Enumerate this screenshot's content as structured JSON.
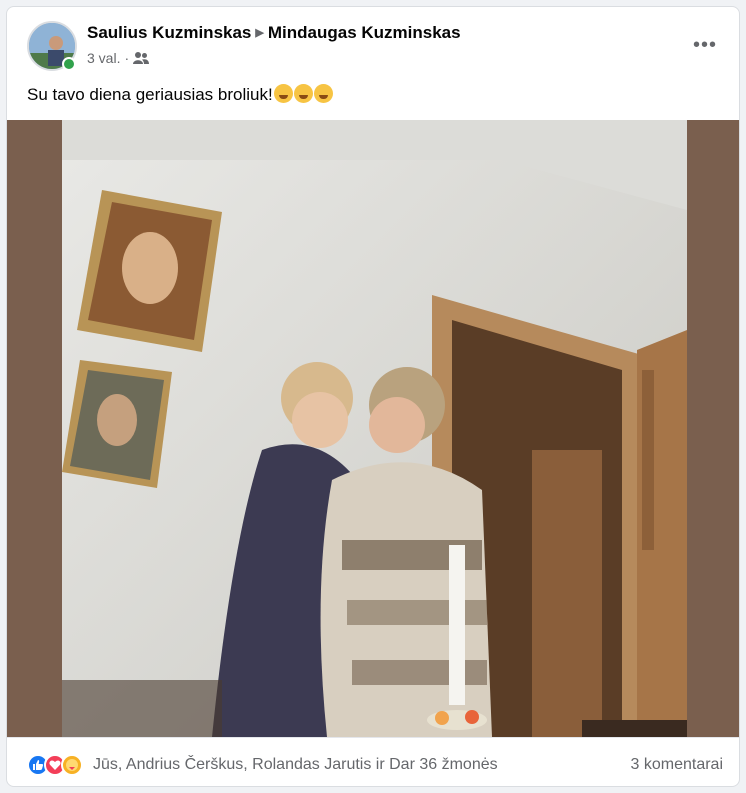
{
  "post": {
    "author": "Saulius Kuzminskas",
    "recipient": "Mindaugas Kuzminskas",
    "time": "3 val.",
    "separator": "·",
    "audience_icon": "friends-icon",
    "more_icon": "more-options-icon",
    "more_label": "•••",
    "text": "Su tavo diena geriausias broliuk!",
    "emoji_count": 3
  },
  "footer": {
    "reaction_icons": [
      "like-icon",
      "love-icon",
      "care-icon"
    ],
    "reactions_text": "Jūs, Andrius Čerškus, Rolandas Jarutis ir Dar 36 žmonės",
    "comments_text": "3 komentarai"
  },
  "colors": {
    "like": "#1877f2",
    "love": "#f33e58",
    "care": "#f7b125",
    "online": "#31a24c",
    "photo_border": "#7a5f4e"
  }
}
